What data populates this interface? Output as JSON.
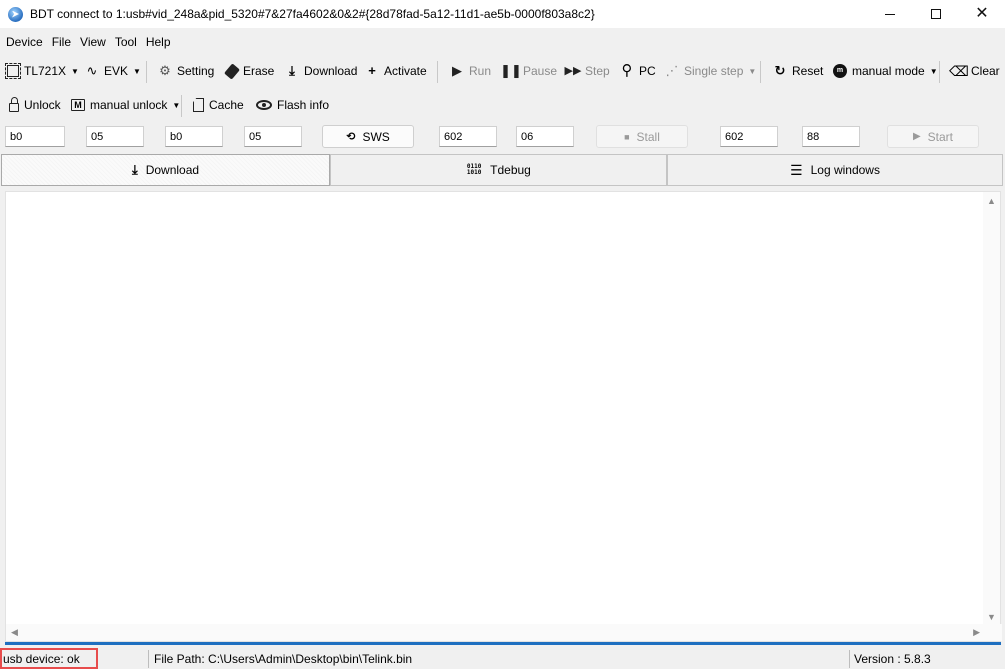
{
  "window": {
    "title": "BDT connect to 1:usb#vid_248a&pid_5320#7&27fa4602&0&2#{28d78fad-5a12-11d1-ae5b-0000f803a8c2}",
    "close_glyph": "✕"
  },
  "menu": [
    "Device",
    "File",
    "View",
    "Tool",
    "Help"
  ],
  "toolbar1": {
    "chip": "TL721X",
    "board": "EVK",
    "setting": "Setting",
    "erase": "Erase",
    "download": "Download",
    "activate": "Activate",
    "run": "Run",
    "pause": "Pause",
    "step": "Step",
    "pc": "PC",
    "single_step": "Single step",
    "reset": "Reset",
    "mode": "manual mode",
    "clear": "Clear"
  },
  "toolbar2": {
    "unlock": "Unlock",
    "manual_unlock": "manual unlock",
    "cache": "Cache",
    "flash_info": "Flash info"
  },
  "fields": {
    "f1": "b0",
    "f2": "05",
    "f3": "b0",
    "f4": "05",
    "sws_label": "SWS",
    "f5": "602",
    "f6": "06",
    "stall_label": "Stall",
    "f7": "602",
    "f8": "88",
    "start_label": "Start"
  },
  "tabs": {
    "download": "Download",
    "tdebug": "Tdebug",
    "log": "Log windows"
  },
  "status": {
    "usb": "usb device: ok",
    "file_path": "File Path:  C:\\Users\\Admin\\Desktop\\bin\\Telink.bin",
    "version": "Version : 5.8.3"
  },
  "colors": {
    "accent_line": "#1e6fc0",
    "status_highlight": "#e74c4c"
  }
}
